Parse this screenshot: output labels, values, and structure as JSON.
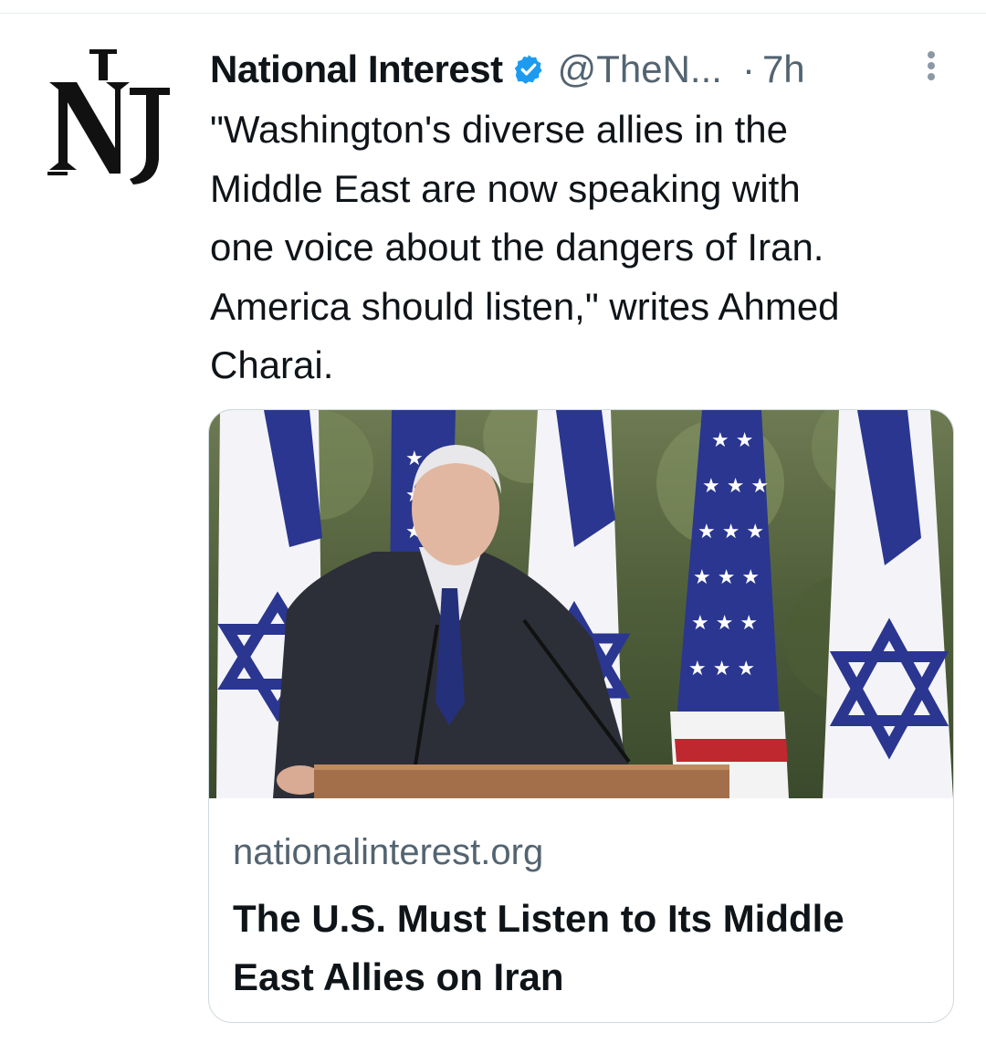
{
  "author": {
    "name": "National Interest",
    "handle": "@TheN...",
    "dot": "·",
    "time": "7h",
    "avatar_logo": "NI",
    "verified_icon": "verified-badge-icon"
  },
  "tweet": {
    "text": "\"Washington's diverse allies in the\nMiddle East are now speaking with\none voice about the dangers of Iran.\nAmerica should listen,\" writes Ahmed\nCharai."
  },
  "link_card": {
    "domain": "nationalinterest.org",
    "title": "The U.S. Must Listen to Its Middle\nEast Allies on Iran"
  },
  "colors": {
    "accent": "#1d9bf0",
    "secondary_text": "#536471",
    "border": "#cfd9de",
    "flag_blue": "#2a3690"
  }
}
